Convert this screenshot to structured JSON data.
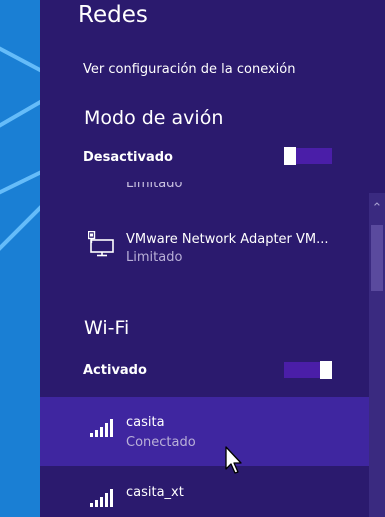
{
  "panel": {
    "title": "Redes",
    "view_settings_link": "Ver configuración de la conexión"
  },
  "airplane_mode": {
    "heading": "Modo de avión",
    "state_label": "Desactivado",
    "enabled": false
  },
  "wired": {
    "clipped_status": "Limitado",
    "items": [
      {
        "name": "VMware Network Adapter VM...",
        "status": "Limitado",
        "icon": "ethernet-icon"
      }
    ]
  },
  "wifi": {
    "heading": "Wi-Fi",
    "state_label": "Activado",
    "enabled": true,
    "networks": [
      {
        "name": "casita",
        "status": "Conectado",
        "icon": "wifi-signal-icon",
        "selected": true
      },
      {
        "name": "casita_xt",
        "status": "",
        "icon": "wifi-signal-icon",
        "selected": false
      }
    ]
  },
  "scrollbar": {
    "up_arrow": "⌃"
  },
  "colors": {
    "panel_bg": "#2b1a6e",
    "selected_bg": "#3f26a0",
    "toggle_track": "#4a1ea8",
    "desktop_bg": "#1a7fd4"
  }
}
